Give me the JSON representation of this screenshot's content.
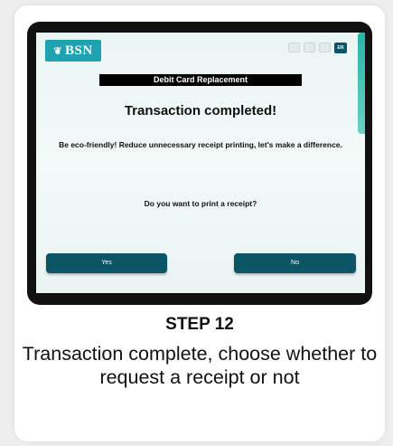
{
  "kiosk": {
    "logo_text": "BSN",
    "languages": [
      "",
      "",
      "",
      "EN"
    ],
    "page_title": "Debit Card Replacement",
    "heading": "Transaction completed!",
    "eco_message": "Be eco-friendly! Reduce unnecessary receipt printing, let's make a difference.",
    "question": "Do you want to print a receipt?",
    "yes_label": "Yes",
    "no_label": "No",
    "accent_color": "#0b5566",
    "logo_color": "#1fa2b2"
  },
  "step": {
    "title": "STEP 12",
    "description": "Transaction complete, choose whether to request a receipt or not"
  }
}
